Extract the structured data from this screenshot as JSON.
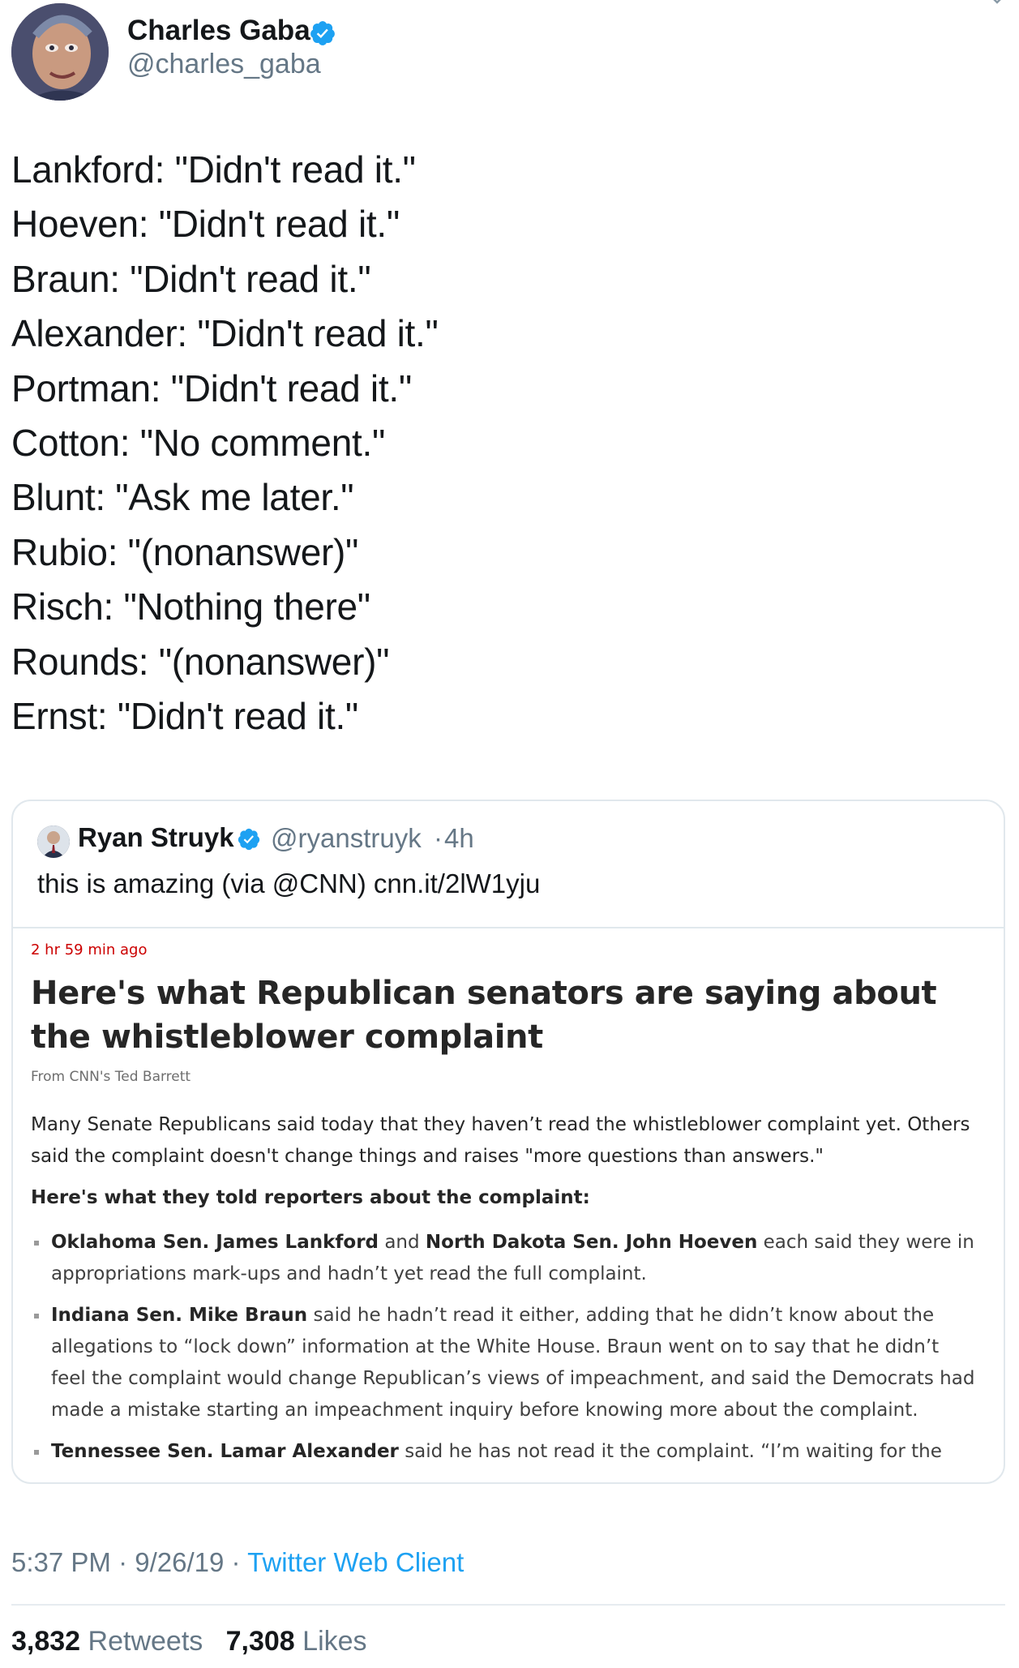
{
  "tweet": {
    "author": {
      "name": "Charles Gaba",
      "handle": "@charles_gaba",
      "verified": true
    },
    "lines": [
      "Lankford: \"Didn't read it.\"",
      "Hoeven: \"Didn't read it.\"",
      "Braun: \"Didn't read it.\"",
      "Alexander: \"Didn't read it.\"",
      "Portman: \"Didn't read it.\"",
      "Cotton: \"No comment.\"",
      "Blunt: \"Ask me later.\"",
      "Rubio: \"(nonanswer)\"",
      "Risch: \"Nothing there\"",
      "Rounds: \"(nonanswer)\"",
      "Ernst: \"Didn't read it.\""
    ],
    "time": "5:37 PM",
    "date": "9/26/19",
    "separator": "·",
    "client": "Twitter Web Client",
    "stats": {
      "retweets_count": "3,832",
      "retweets_label": "Retweets",
      "likes_count": "7,308",
      "likes_label": "Likes"
    }
  },
  "quoted": {
    "name": "Ryan Struyk",
    "handle": "@ryanstruyk",
    "separator": "·",
    "time": "4h",
    "text": "this is amazing (via @CNN) cnn.it/2lW1yju",
    "article": {
      "time": "2 hr 59 min ago",
      "headline": "Here's what Republican senators are saying about the whistleblower complaint",
      "byline": "From CNN's Ted Barrett",
      "intro": "Many Senate Republicans said today that they haven’t read the whistleblower complaint yet. Others said the complaint doesn't change things and raises \"more questions than answers.\"",
      "subhead": "Here's what they told reporters about the complaint:",
      "bullets": [
        {
          "bold1": "Oklahoma Sen. James Lankford",
          "mid": " and ",
          "bold2": "North Dakota Sen. John Hoeven",
          "rest": " each said they were in appropriations mark-ups and hadn’t yet read the full complaint."
        },
        {
          "bold1": "Indiana Sen. Mike Braun",
          "rest": " said he hadn’t read it either, adding that he didn’t know about the allegations to “lock down” information at the White House. Braun went on to say that he didn’t feel the complaint would change Republican’s views of impeachment, and said the Democrats had made a mistake starting an impeachment inquiry before knowing more about the complaint."
        },
        {
          "bold1": "Tennessee Sen. Lamar Alexander",
          "rest": " said he has not read it the complaint. “I’m waiting for the"
        }
      ]
    }
  },
  "colors": {
    "twitter_blue": "#1da1f2",
    "text_primary": "#14171a",
    "text_secondary": "#657786",
    "border": "#e1e8ed",
    "cnn_red": "#cc0000"
  },
  "icons": {
    "verified": "verified-badge-icon",
    "more": "chevron-down-icon"
  }
}
